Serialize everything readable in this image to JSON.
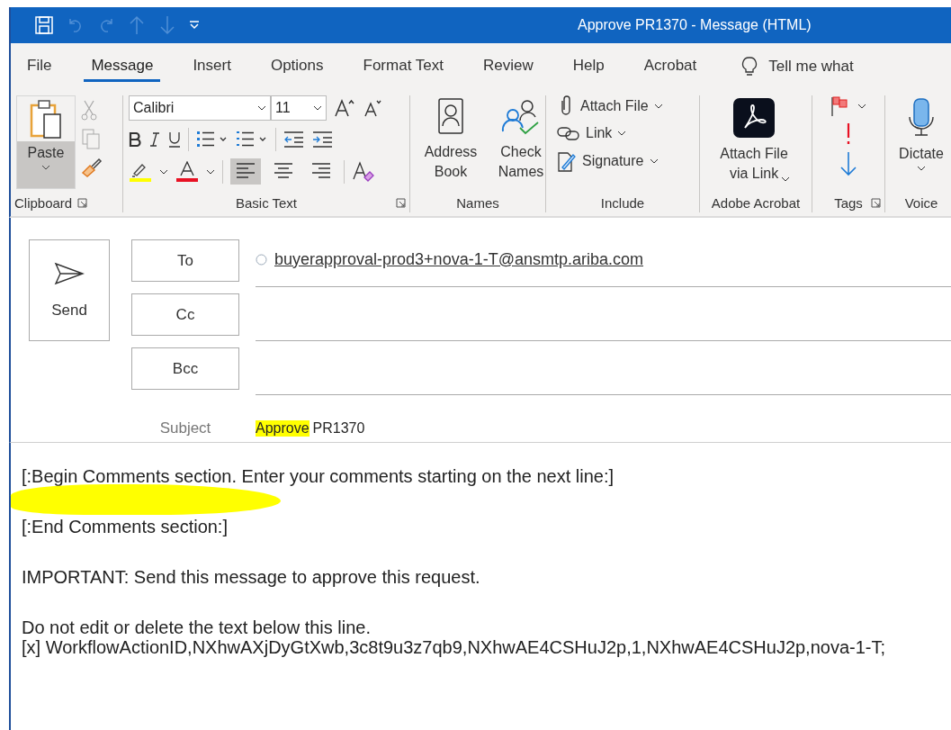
{
  "title_bar": {
    "title": "Approve PR1370  -  Message (HTML)"
  },
  "tabs": [
    {
      "label": "File",
      "selected": false
    },
    {
      "label": "Message",
      "selected": true
    },
    {
      "label": "Insert",
      "selected": false
    },
    {
      "label": "Options",
      "selected": false
    },
    {
      "label": "Format Text",
      "selected": false
    },
    {
      "label": "Review",
      "selected": false
    },
    {
      "label": "Help",
      "selected": false
    },
    {
      "label": "Acrobat",
      "selected": false
    }
  ],
  "tell_me": "Tell me what",
  "ribbon": {
    "clipboard": {
      "paste": "Paste",
      "label": "Clipboard"
    },
    "basic_text": {
      "font": "Calibri",
      "size": "11",
      "label": "Basic Text",
      "align": [
        {
          "selected": true
        },
        {
          "selected": false
        },
        {
          "selected": false
        }
      ]
    },
    "names": {
      "buttons": [
        "Address Book",
        "Check Names"
      ],
      "label": "Names"
    },
    "include": {
      "items": [
        "Attach File",
        "Link",
        "Signature"
      ],
      "label": "Include"
    },
    "adobe": {
      "button": "Attach File via Link",
      "label": "Adobe Acrobat"
    },
    "tags": {
      "label": "Tags"
    },
    "voice": {
      "button": "Dictate",
      "label": "Voice"
    }
  },
  "send": "Send",
  "recipients": [
    {
      "label": "To",
      "value": "buyerapproval-prod3+nova-1-T@ansmtp.ariba.com"
    },
    {
      "label": "Cc"
    },
    {
      "label": "Bcc"
    }
  ],
  "subject": {
    "label": "Subject",
    "parts": [
      {
        "text": "Approve",
        "highlighted": true
      },
      {
        "text": "PR1370",
        "highlighted": false
      }
    ]
  },
  "body": [
    {
      "lines": [
        "[:Begin Comments section. Enter your comments starting on the next line:]"
      ],
      "highlight_below": true
    },
    {
      "lines": [
        "[:End Comments section:]"
      ],
      "highlight_below": false
    },
    {
      "lines": [
        "IMPORTANT: Send this message to approve this request."
      ],
      "highlight_below": false
    },
    {
      "lines": [
        "Do not edit or delete the text below this line.",
        "[x] WorkflowActionID,NXhwAXjDyGtXwb,3c8t9u3z7qb9,NXhwAE4CSHuJ2p,1,NXhwAE4CSHuJ2p,nova-1-T;"
      ],
      "highlight_below": false
    }
  ]
}
